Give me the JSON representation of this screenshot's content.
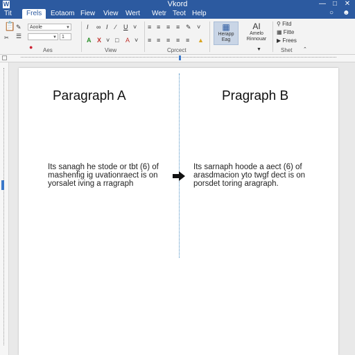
{
  "window": {
    "app_icon": "W",
    "title": "Vkord"
  },
  "window_controls": [
    "minimize-icon",
    "maximize-icon",
    "close-icon"
  ],
  "menu": {
    "items": [
      "Tit",
      "Frels",
      "Eotaom",
      "Fiew",
      "View",
      "Wert",
      "Wetr",
      "Teot",
      "Help"
    ],
    "active_index": 1
  },
  "ribbon": {
    "font_name": "Aoole",
    "font_size": "1",
    "group_labels": [
      "Aes",
      "View",
      "Cprcect",
      "Shet"
    ],
    "big_btn_1_label": "Herapp\nEag",
    "big_btn_2_label": "Amelo\nRinnouar",
    "ai_label": "AI",
    "right_items": [
      "Fitd",
      "Fitte",
      "Frees"
    ]
  },
  "document": {
    "col_a_title": "Paragraph A",
    "col_b_title": "Pragraph B",
    "col_a_lines": [
      "Its sanagh he stode or tbt (6) of",
      "mashenfig ig uvationraect is on",
      "yorsalet iving a rragraph"
    ],
    "col_b_lines": [
      "Its sarnaph hoode a aect (6) of",
      "arasdmacion yto twgf dect is on",
      "porsdet toring aragraph."
    ]
  },
  "colors": {
    "titlebar": "#2c5aa0",
    "divider": "#4a8fc4",
    "ruler_marker": "#3b78c9"
  }
}
